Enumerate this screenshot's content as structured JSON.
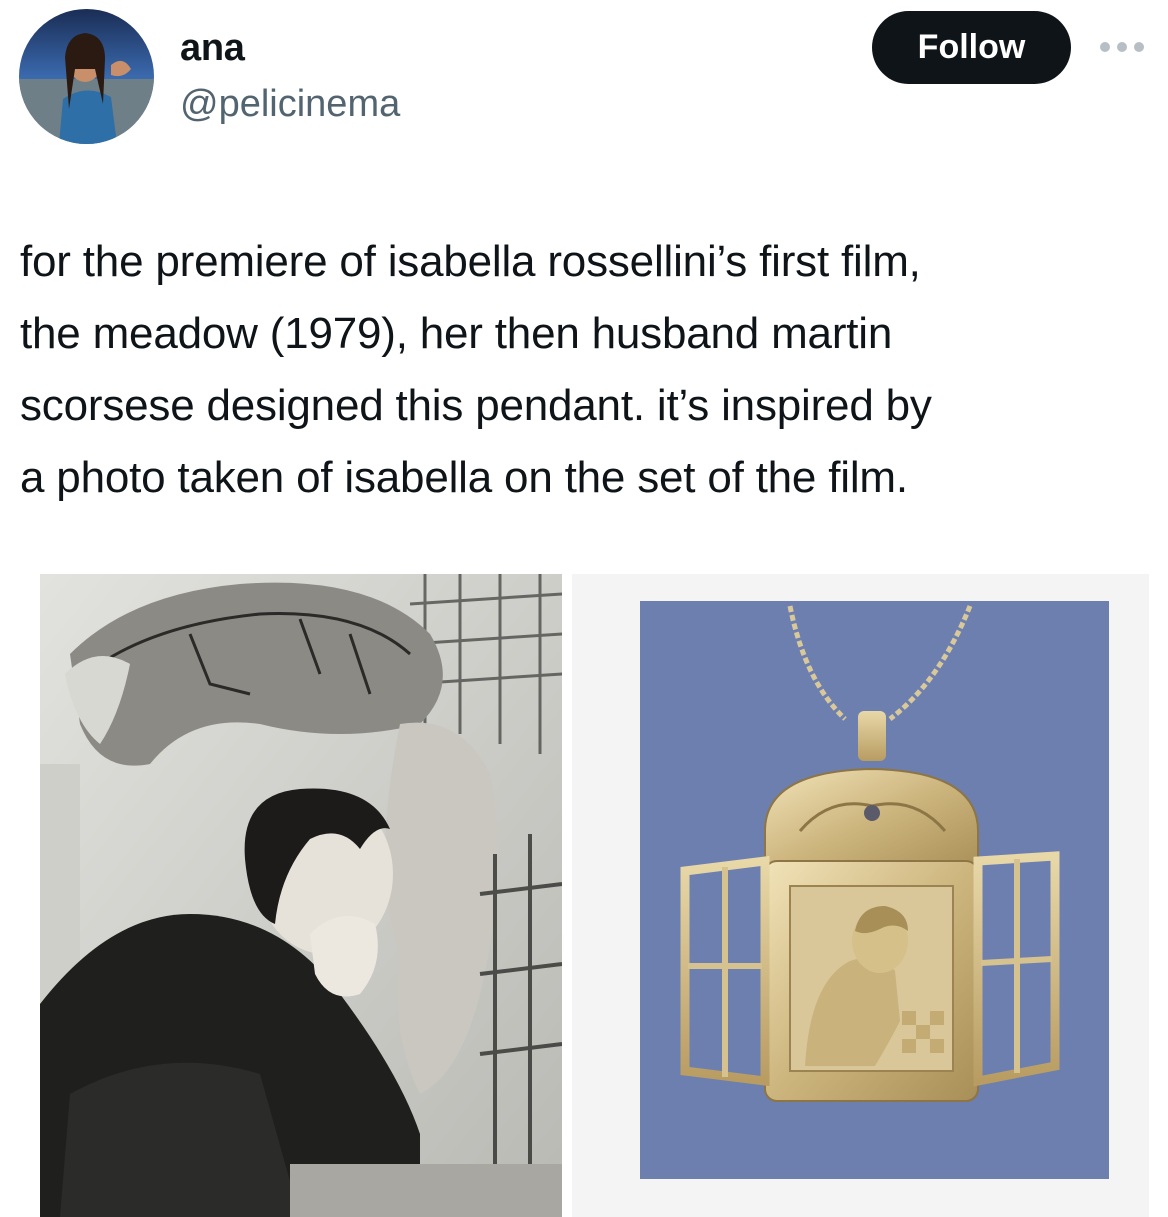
{
  "user": {
    "display_name": "ana",
    "handle": "@pelicinema",
    "avatar_icon": "profile-photo-avatar"
  },
  "actions": {
    "follow_label": "Follow",
    "more_icon": "more-options-icon"
  },
  "tweet": {
    "lines": [
      "for the premiere of isabella rossellini’s first film,",
      "the meadow (1979), her then husband martin",
      "scorsese designed this pendant. it’s inspired by",
      "a photo taken of isabella on the set of the film."
    ]
  },
  "media": {
    "left_image_icon": "black-and-white-photo",
    "right_image_icon": "gold-pendant-photo"
  },
  "colors": {
    "text_primary": "#0f1419",
    "text_secondary": "#536471",
    "button_bg": "#0f1419",
    "pendant_background": "#6d7fae"
  }
}
